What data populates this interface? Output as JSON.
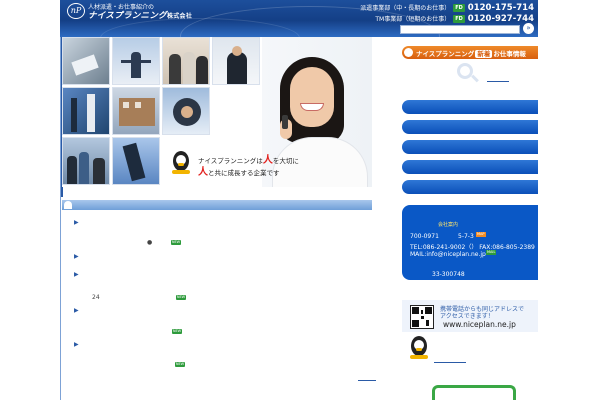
{
  "header": {
    "logo_mark": "nP",
    "logo_subtitle": "人材派遣・お仕事紹介の",
    "logo_name": "ナイスプランニング",
    "logo_suffix": "株式会社",
    "contacts": [
      {
        "dept": "派遣事業部（中・長期のお仕事）",
        "badge": "FD",
        "tel": "0120-175-714"
      },
      {
        "dept": "TM事業部（短期のお仕事）",
        "badge": "FD",
        "tel": "0120-927-744"
      }
    ],
    "search_placeholder": "",
    "search_button": "»"
  },
  "hero": {
    "line1_prefix": "ナイスプランニングは",
    "line1_hi": "人",
    "line1_suffix": "を大切に",
    "line2_hi": "人",
    "line2_suffix": "と共に成長する企業です"
  },
  "news": {
    "items": [
      {
        "extra": "●",
        "badge": "NEW"
      },
      {
        "extra": "",
        "badge": ""
      },
      {
        "extra": "24",
        "badge": "NEW"
      },
      {
        "extra": "",
        "badge": "NEW"
      },
      {
        "extra": "",
        "badge": "NEW"
      }
    ]
  },
  "sidebar": {
    "new_info_prefix": "ナイスプランニング",
    "new_info_tag": "新着",
    "new_info_suffix": "お仕事情報"
  },
  "company": {
    "title": "会社案内",
    "postal": "700-0971",
    "address_num": "5-7-3",
    "map_badge": "MAP",
    "tel_fax": "TEL:086-241-9002（） FAX:086-805-2389",
    "mail": "MAIL:info@niceplan.ne.jp",
    "mail_badge": "MAIL",
    "license": "33-300748"
  },
  "mobile": {
    "line1": "携帯電話からも同じアドレスで",
    "line2": "アクセスできます！",
    "url": "www.niceplan.ne.jp"
  },
  "colors": {
    "header_blue": "#143f86",
    "accent_orange": "#d85f0f",
    "sidebar_blue": "#0a58c6",
    "badge_green": "#2e9b3c",
    "highlight_red": "#e2201d"
  }
}
